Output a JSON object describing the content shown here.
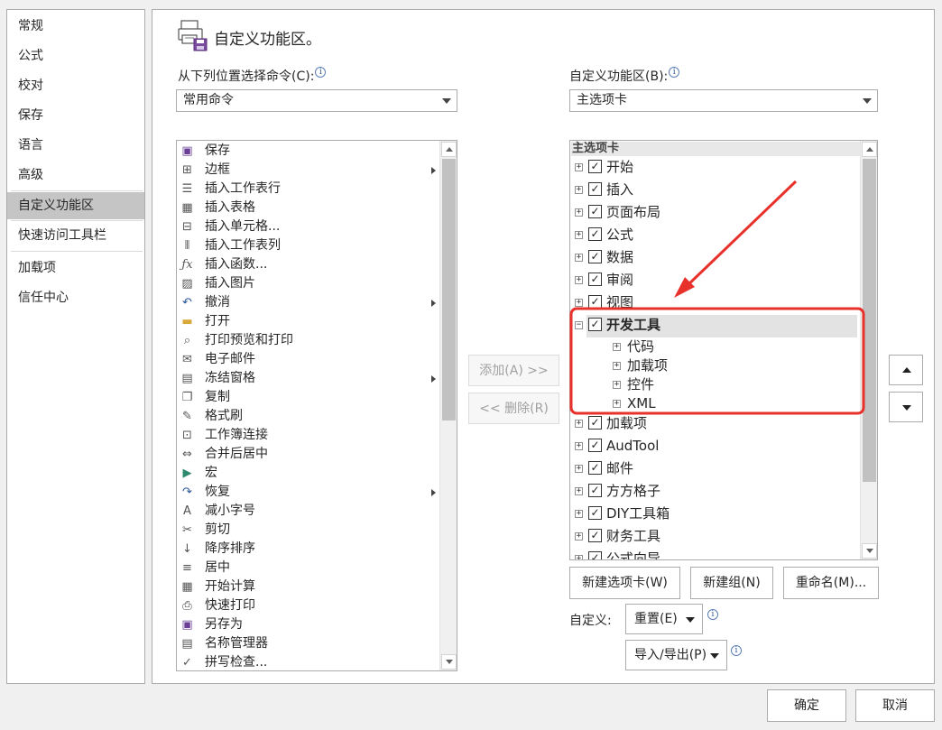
{
  "nav": {
    "items": [
      "常规",
      "公式",
      "校对",
      "保存",
      "语言",
      "高级",
      "自定义功能区",
      "快速访问工具栏",
      "加载项",
      "信任中心"
    ],
    "selected": "自定义功能区"
  },
  "header": {
    "icon": "ribbon-customize-icon",
    "title": "自定义功能区。"
  },
  "left": {
    "label": "从下列位置选择命令(C):",
    "combo_value": "常用命令",
    "commands": [
      {
        "label": "保存",
        "icon": "save-icon"
      },
      {
        "label": "边框",
        "icon": "border-icon",
        "sub": true
      },
      {
        "label": "插入工作表行",
        "icon": "insert-row-icon"
      },
      {
        "label": "插入表格",
        "icon": "table-icon"
      },
      {
        "label": "插入单元格...",
        "icon": "insert-cell-icon"
      },
      {
        "label": "插入工作表列",
        "icon": "insert-column-icon"
      },
      {
        "label": "插入函数...",
        "icon": "function-icon"
      },
      {
        "label": "插入图片",
        "icon": "picture-icon"
      },
      {
        "label": "撤消",
        "icon": "undo-icon",
        "sub": true
      },
      {
        "label": "打开",
        "icon": "folder-icon"
      },
      {
        "label": "打印预览和打印",
        "icon": "print-preview-icon"
      },
      {
        "label": "电子邮件",
        "icon": "email-icon"
      },
      {
        "label": "冻结窗格",
        "icon": "freeze-panes-icon",
        "sub": true
      },
      {
        "label": "复制",
        "icon": "copy-icon"
      },
      {
        "label": "格式刷",
        "icon": "format-painter-icon"
      },
      {
        "label": "工作簿连接",
        "icon": "workbook-connections-icon"
      },
      {
        "label": "合并后居中",
        "icon": "merge-center-icon"
      },
      {
        "label": "宏",
        "icon": "macro-icon"
      },
      {
        "label": "恢复",
        "icon": "redo-icon",
        "sub": true
      },
      {
        "label": "减小字号",
        "icon": "decrease-font-icon"
      },
      {
        "label": "剪切",
        "icon": "cut-icon"
      },
      {
        "label": "降序排序",
        "icon": "sort-descending-icon"
      },
      {
        "label": "居中",
        "icon": "align-center-icon"
      },
      {
        "label": "开始计算",
        "icon": "calculator-icon"
      },
      {
        "label": "快速打印",
        "icon": "quick-print-icon"
      },
      {
        "label": "另存为",
        "icon": "save-as-icon"
      },
      {
        "label": "名称管理器",
        "icon": "name-manager-icon"
      },
      {
        "label": "拼写检查...",
        "icon": "spelling-icon"
      }
    ]
  },
  "middle": {
    "add": "添加(A) >>",
    "remove": "<< 删除(R)"
  },
  "right": {
    "label": "自定义功能区(B):",
    "combo_value": "主选项卡",
    "tree_header": "主选项卡",
    "tree": [
      {
        "label": "开始",
        "level": 0,
        "expanded": false
      },
      {
        "label": "插入",
        "level": 0,
        "expanded": false
      },
      {
        "label": "页面布局",
        "level": 0,
        "expanded": false
      },
      {
        "label": "公式",
        "level": 0,
        "expanded": false
      },
      {
        "label": "数据",
        "level": 0,
        "expanded": false
      },
      {
        "label": "审阅",
        "level": 0,
        "expanded": false
      },
      {
        "label": "视图",
        "level": 0,
        "expanded": false
      },
      {
        "label": "开发工具",
        "level": 0,
        "expanded": true,
        "selected": true
      },
      {
        "label": "代码",
        "level": 1
      },
      {
        "label": "加载项",
        "level": 1
      },
      {
        "label": "控件",
        "level": 1
      },
      {
        "label": "XML",
        "level": 1
      },
      {
        "label": "加载项",
        "level": 0,
        "expanded": false
      },
      {
        "label": "AudTool",
        "level": 0,
        "expanded": false
      },
      {
        "label": "邮件",
        "level": 0,
        "expanded": false
      },
      {
        "label": "方方格子",
        "level": 0,
        "expanded": false
      },
      {
        "label": "DIY工具箱",
        "level": 0,
        "expanded": false
      },
      {
        "label": "财务工具",
        "level": 0,
        "expanded": false
      },
      {
        "label": "公式向导",
        "level": 0,
        "expanded": false
      }
    ],
    "new_tab": "新建选项卡(W)",
    "new_group": "新建组(N)",
    "rename": "重命名(M)...",
    "customize_label": "自定义:",
    "reset": "重置(E)",
    "import_export": "导入/导出(P)"
  },
  "footer": {
    "ok": "确定",
    "cancel": "取消"
  },
  "colors": {
    "highlight_box": "#e8312a",
    "selected_nav": "#c5c5c5",
    "tree_selected": "#e3e3e3"
  }
}
